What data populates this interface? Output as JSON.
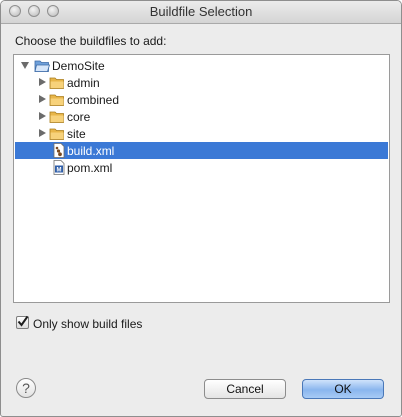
{
  "window": {
    "title": "Buildfile Selection"
  },
  "prompt": "Choose the buildfiles to add:",
  "tree": {
    "root": {
      "label": "DemoSite",
      "icon": "folder-open-icon"
    },
    "items": [
      {
        "label": "admin",
        "icon": "folder-icon"
      },
      {
        "label": "combined",
        "icon": "folder-icon"
      },
      {
        "label": "core",
        "icon": "folder-icon"
      },
      {
        "label": "site",
        "icon": "folder-icon"
      },
      {
        "label": "build.xml",
        "icon": "ant-file-icon"
      },
      {
        "label": "pom.xml",
        "icon": "maven-file-icon"
      }
    ],
    "selected": "build.xml"
  },
  "option": {
    "label": "Only show build files",
    "checked": true
  },
  "buttons": {
    "cancel": "Cancel",
    "ok": "OK",
    "help": "?"
  },
  "colors": {
    "selection": "#3b79d6",
    "default_button": "#8ab6ee"
  }
}
